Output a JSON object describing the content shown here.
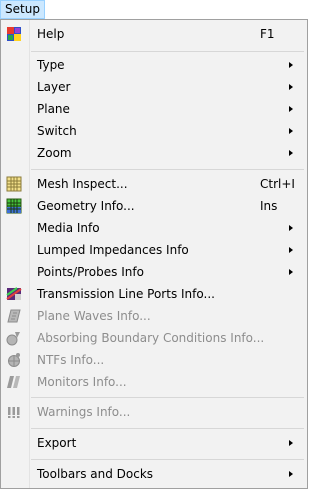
{
  "menubar": {
    "active_menu": "Setup"
  },
  "menu": {
    "items": [
      {
        "label": "Help",
        "shortcut": "F1",
        "icon": "help-icon",
        "disabled": false,
        "submenu": false
      },
      {
        "label": "Type",
        "shortcut": "",
        "icon": "",
        "disabled": false,
        "submenu": true
      },
      {
        "label": "Layer",
        "shortcut": "",
        "icon": "",
        "disabled": false,
        "submenu": true
      },
      {
        "label": "Plane",
        "shortcut": "",
        "icon": "",
        "disabled": false,
        "submenu": true
      },
      {
        "label": "Switch",
        "shortcut": "",
        "icon": "",
        "disabled": false,
        "submenu": true
      },
      {
        "label": "Zoom",
        "shortcut": "",
        "icon": "",
        "disabled": false,
        "submenu": true
      },
      {
        "label": "Mesh Inspect...",
        "shortcut": "Ctrl+I",
        "icon": "mesh-grid-icon",
        "disabled": false,
        "submenu": false
      },
      {
        "label": "Geometry Info...",
        "shortcut": "Ins",
        "icon": "geometry-grid-icon",
        "disabled": false,
        "submenu": false
      },
      {
        "label": "Media Info",
        "shortcut": "",
        "icon": "",
        "disabled": false,
        "submenu": true
      },
      {
        "label": "Lumped Impedances Info",
        "shortcut": "",
        "icon": "",
        "disabled": false,
        "submenu": true
      },
      {
        "label": "Points/Probes Info",
        "shortcut": "",
        "icon": "",
        "disabled": false,
        "submenu": true
      },
      {
        "label": "Transmission Line Ports Info...",
        "shortcut": "",
        "icon": "transmission-line-icon",
        "disabled": false,
        "submenu": false
      },
      {
        "label": "Plane Waves Info...",
        "shortcut": "",
        "icon": "plane-wave-icon",
        "disabled": true,
        "submenu": false
      },
      {
        "label": "Absorbing Boundary Conditions Info...",
        "shortcut": "",
        "icon": "absorbing-boundary-icon",
        "disabled": true,
        "submenu": false
      },
      {
        "label": "NTFs Info...",
        "shortcut": "",
        "icon": "ntf-icon",
        "disabled": true,
        "submenu": false
      },
      {
        "label": "Monitors Info...",
        "shortcut": "",
        "icon": "monitor-icon",
        "disabled": true,
        "submenu": false
      },
      {
        "label": "Warnings Info...",
        "shortcut": "",
        "icon": "warning-icon",
        "disabled": true,
        "submenu": false
      },
      {
        "label": "Export",
        "shortcut": "",
        "icon": "",
        "disabled": false,
        "submenu": true
      },
      {
        "label": "Toolbars and Docks",
        "shortcut": "",
        "icon": "",
        "disabled": false,
        "submenu": true
      }
    ]
  },
  "colors": {
    "highlight": "#cce8ff",
    "menu_bg": "#f2f2f2",
    "disabled_text": "#8d8d8d"
  }
}
